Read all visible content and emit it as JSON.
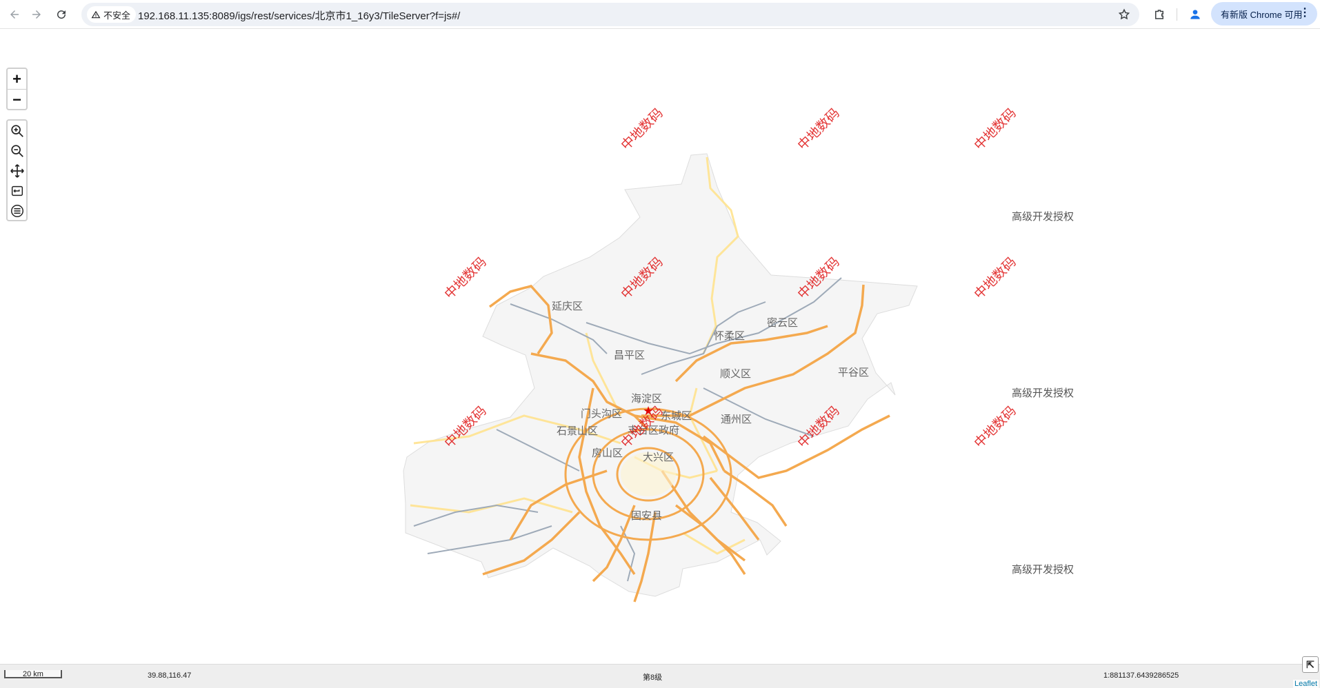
{
  "browser": {
    "security_label": "不安全",
    "url": "192.168.11.135:8089/igs/rest/services/北京市1_16y3/TileServer?f=js#/",
    "update_label": "有新版 Chrome 可用"
  },
  "map": {
    "zoom_in_label": "+",
    "zoom_out_label": "−",
    "tools": [
      "zoom-in-tool-icon",
      "zoom-out-tool-icon",
      "pan-tool-icon",
      "reset-view-icon",
      "layer-list-icon"
    ],
    "districts": [
      {
        "name": "延庆区"
      },
      {
        "name": "怀柔区"
      },
      {
        "name": "密云区"
      },
      {
        "name": "昌平区"
      },
      {
        "name": "顺义区"
      },
      {
        "name": "平谷区"
      },
      {
        "name": "海淀区"
      },
      {
        "name": "门头沟区"
      },
      {
        "name": "东城区"
      },
      {
        "name": "通州区"
      },
      {
        "name": "石景山区"
      },
      {
        "name": "丰台区政府"
      },
      {
        "name": "房山区"
      },
      {
        "name": "大兴区"
      },
      {
        "name": "固安县"
      }
    ],
    "watermark_text": "中地数码",
    "license_text": "高级开发授权",
    "capital_marker": "★"
  },
  "status": {
    "scale_label": "20 km",
    "coordinates": "39.88,116.47",
    "level": "第8级",
    "scale_ratio": "1:881137.6439286525",
    "attribution": "Leaflet"
  }
}
